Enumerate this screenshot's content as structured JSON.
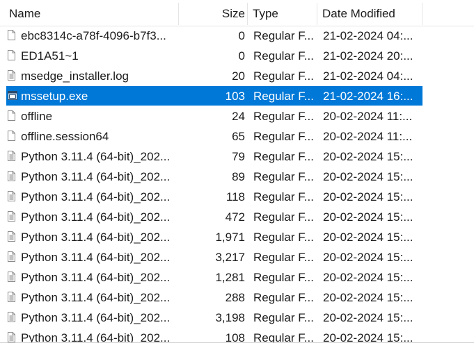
{
  "columns": {
    "name": "Name",
    "size": "Size",
    "type": "Type",
    "date_modified": "Date Modified"
  },
  "files": [
    {
      "name": "ebc8314c-a78f-4096-b7f3...",
      "size": "0",
      "type": "Regular F...",
      "date": "21-02-2024 04:...",
      "icon": "blank-file-icon",
      "selected": false
    },
    {
      "name": "ED1A51~1",
      "size": "0",
      "type": "Regular F...",
      "date": "21-02-2024 20:...",
      "icon": "blank-file-icon",
      "selected": false
    },
    {
      "name": "msedge_installer.log",
      "size": "20",
      "type": "Regular F...",
      "date": "21-02-2024 04:...",
      "icon": "text-file-icon",
      "selected": false
    },
    {
      "name": "mssetup.exe",
      "size": "103",
      "type": "Regular F...",
      "date": "21-02-2024 16:...",
      "icon": "executable-file-icon",
      "selected": true
    },
    {
      "name": "offline",
      "size": "24",
      "type": "Regular F...",
      "date": "20-02-2024 11:...",
      "icon": "blank-file-icon",
      "selected": false
    },
    {
      "name": "offline.session64",
      "size": "65",
      "type": "Regular F...",
      "date": "20-02-2024 11:...",
      "icon": "blank-file-icon",
      "selected": false
    },
    {
      "name": "Python 3.11.4 (64-bit)_202...",
      "size": "79",
      "type": "Regular F...",
      "date": "20-02-2024 15:...",
      "icon": "text-file-icon",
      "selected": false
    },
    {
      "name": "Python 3.11.4 (64-bit)_202...",
      "size": "89",
      "type": "Regular F...",
      "date": "20-02-2024 15:...",
      "icon": "text-file-icon",
      "selected": false
    },
    {
      "name": "Python 3.11.4 (64-bit)_202...",
      "size": "118",
      "type": "Regular F...",
      "date": "20-02-2024 15:...",
      "icon": "text-file-icon",
      "selected": false
    },
    {
      "name": "Python 3.11.4 (64-bit)_202...",
      "size": "472",
      "type": "Regular F...",
      "date": "20-02-2024 15:...",
      "icon": "text-file-icon",
      "selected": false
    },
    {
      "name": "Python 3.11.4 (64-bit)_202...",
      "size": "1,971",
      "type": "Regular F...",
      "date": "20-02-2024 15:...",
      "icon": "text-file-icon",
      "selected": false
    },
    {
      "name": "Python 3.11.4 (64-bit)_202...",
      "size": "3,217",
      "type": "Regular F...",
      "date": "20-02-2024 15:...",
      "icon": "text-file-icon",
      "selected": false
    },
    {
      "name": "Python 3.11.4 (64-bit)_202...",
      "size": "1,281",
      "type": "Regular F...",
      "date": "20-02-2024 15:...",
      "icon": "text-file-icon",
      "selected": false
    },
    {
      "name": "Python 3.11.4 (64-bit)_202...",
      "size": "288",
      "type": "Regular F...",
      "date": "20-02-2024 15:...",
      "icon": "text-file-icon",
      "selected": false
    },
    {
      "name": "Python 3.11.4 (64-bit)_202...",
      "size": "3,198",
      "type": "Regular F...",
      "date": "20-02-2024 15:...",
      "icon": "text-file-icon",
      "selected": false
    },
    {
      "name": "Python 3.11.4 (64-bit)_202...",
      "size": "108",
      "type": "Regular F...",
      "date": "20-02-2024 15:...",
      "icon": "text-file-icon",
      "selected": false
    }
  ],
  "colors": {
    "selection": "#0078d7",
    "text": "#1b1b1b",
    "selected_text": "#ffffff"
  }
}
